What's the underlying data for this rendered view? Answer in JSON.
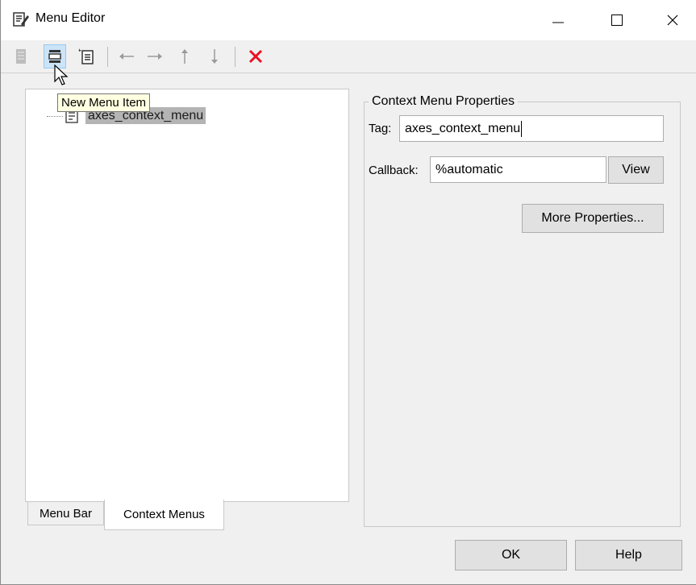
{
  "window": {
    "title": "Menu Editor",
    "icon": "menu-editor-icon"
  },
  "toolbar": {
    "buttons": [
      {
        "name": "new-menu-icon",
        "enabled": false
      },
      {
        "name": "new-menu-item-icon",
        "enabled": true,
        "active": true
      },
      {
        "name": "new-context-menu-icon",
        "enabled": true
      },
      {
        "name": "move-left-icon",
        "enabled": false
      },
      {
        "name": "move-right-icon",
        "enabled": false
      },
      {
        "name": "move-up-icon",
        "enabled": false
      },
      {
        "name": "move-down-icon",
        "enabled": false
      },
      {
        "name": "delete-icon",
        "enabled": true,
        "color": "#e81123"
      }
    ]
  },
  "tooltip": {
    "text": "New Menu Item"
  },
  "tree": {
    "items": [
      {
        "label": "axes_context_menu",
        "selected": true,
        "icon": "context-menu-icon"
      }
    ]
  },
  "tabs": {
    "menu_bar": "Menu Bar",
    "context_menus": "Context Menus",
    "active": "Context Menus"
  },
  "properties": {
    "title": "Context Menu Properties",
    "tag_label": "Tag:",
    "tag_value": "axes_context_menu",
    "callback_label": "Callback:",
    "callback_value": "%automatic",
    "view_button": "View",
    "more_properties_button": "More Properties..."
  },
  "footer": {
    "ok_button": "OK",
    "help_button": "Help"
  },
  "colors": {
    "selection_bg": "#b4b4b4",
    "tooltip_bg": "#ffffe1",
    "delete_red": "#e81123"
  }
}
